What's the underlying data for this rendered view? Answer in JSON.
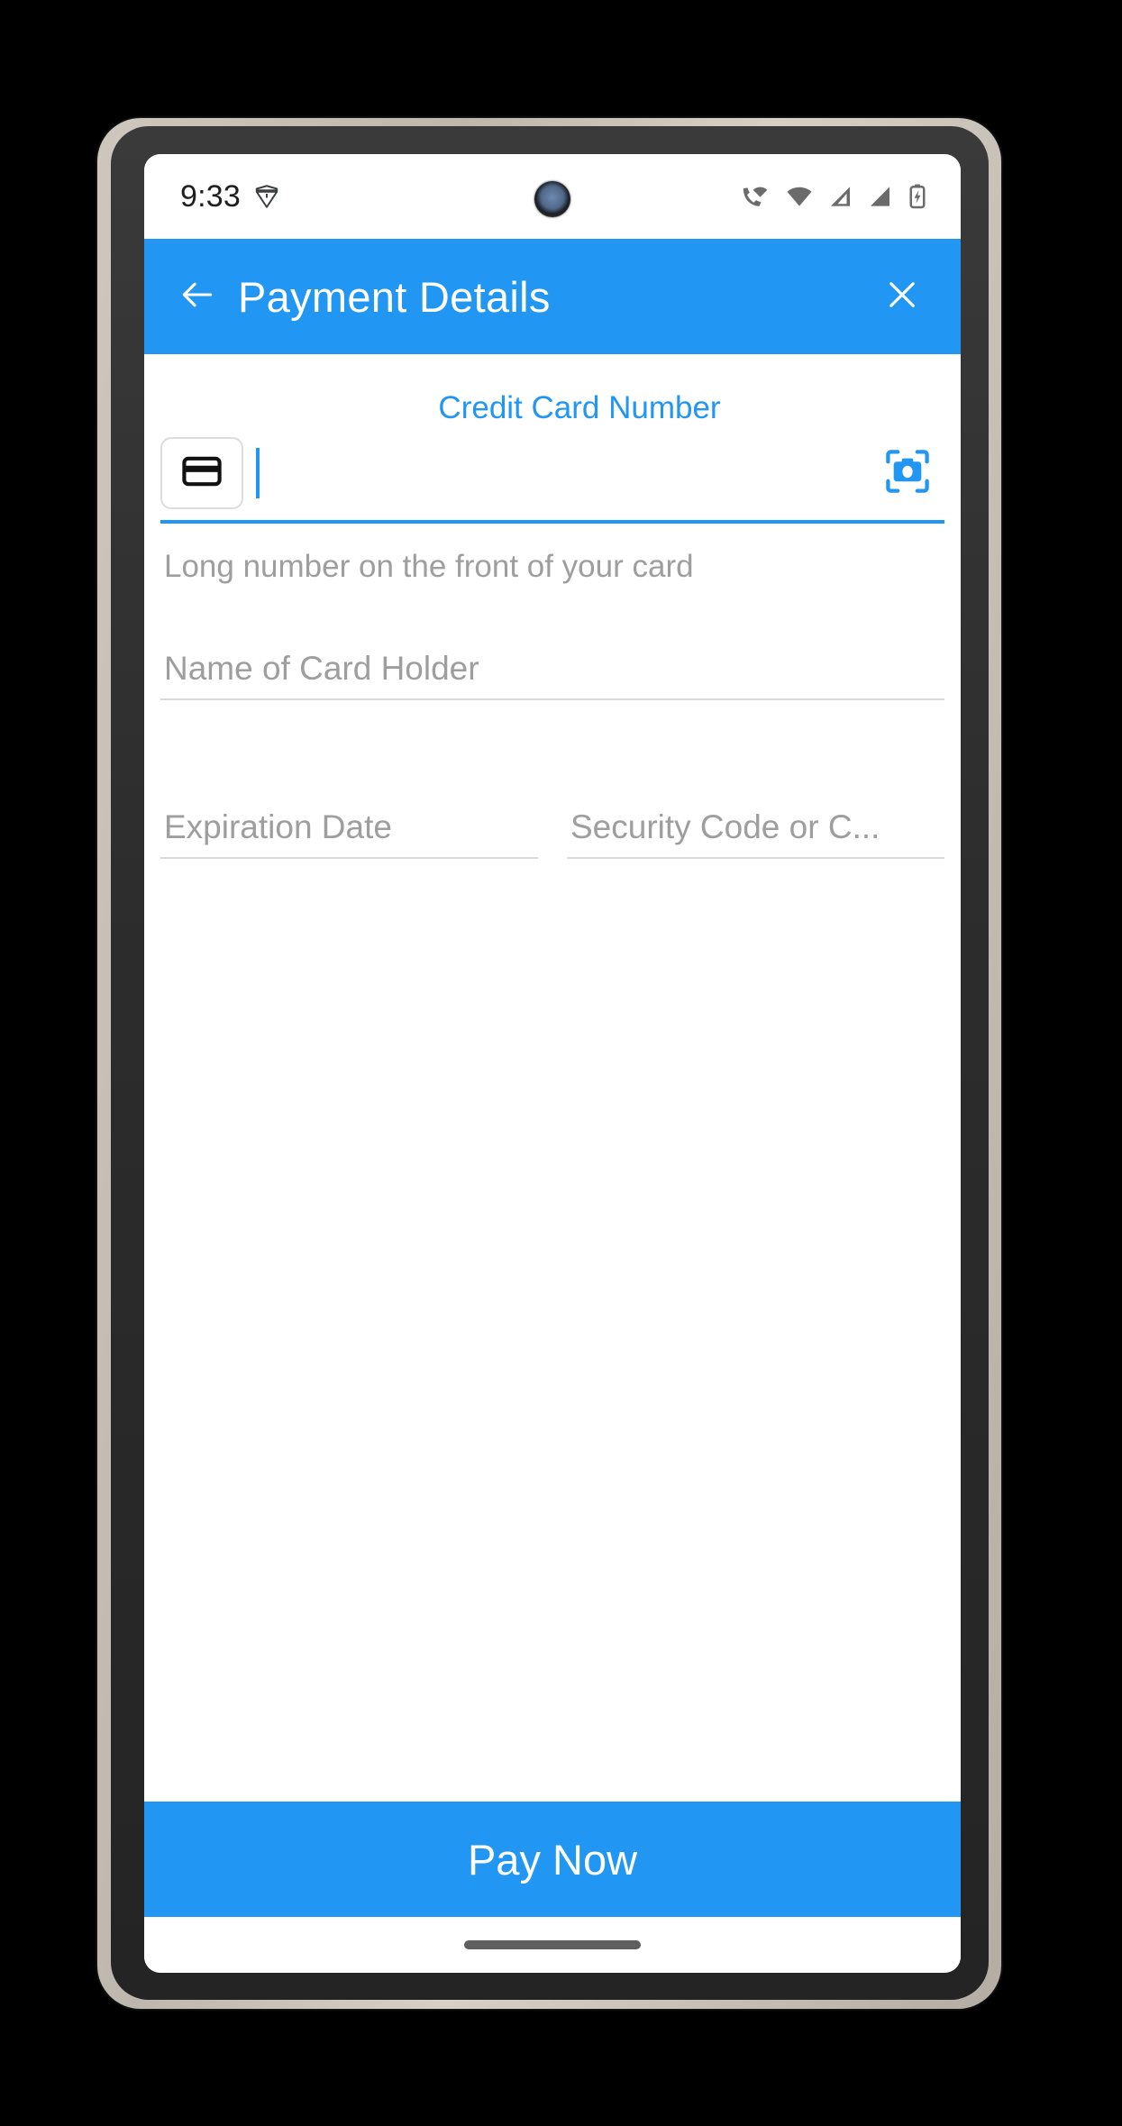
{
  "status_bar": {
    "time": "9:33",
    "left_icons": [
      "shield-down-icon"
    ],
    "right_icons": [
      "volte-call-wifi-icon",
      "wifi-icon",
      "signal-bars-icon",
      "signal-bars-icon",
      "battery-charging-icon"
    ]
  },
  "app_bar": {
    "back_icon": "arrow-left-icon",
    "title": "Payment Details",
    "close_icon": "close-icon",
    "background_color": "#2196f3",
    "text_color": "#ffffff"
  },
  "form": {
    "credit_card": {
      "label": "Credit Card Number",
      "label_color": "#2196f3",
      "value": "",
      "placeholder": "",
      "card_icon": "credit-card-icon",
      "scan_icon": "camera-scan-icon",
      "underline_color": "#2196f3",
      "helper_text": "Long number on the front of your card"
    },
    "card_holder": {
      "placeholder": "Name of Card Holder",
      "value": ""
    },
    "expiration": {
      "placeholder": "Expiration Date",
      "value": ""
    },
    "security_code": {
      "placeholder": "Security Code or C...",
      "value": ""
    }
  },
  "footer": {
    "pay_label": "Pay Now",
    "pay_background": "#2196f3"
  }
}
